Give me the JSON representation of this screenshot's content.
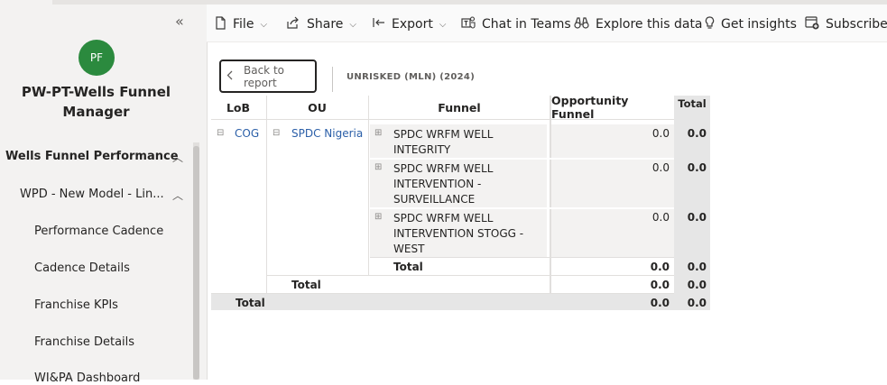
{
  "sidebar": {
    "collapse_glyph": "«",
    "avatar_initials": "PF",
    "app_title": "PW-PT-Wells Funnel Manager",
    "section": "Wells Funnel Performance",
    "subsection": "WPD - New Model - Lin...",
    "pages": [
      "Performance Cadence",
      "Cadence Details",
      "Franchise KPIs",
      "Franchise Details",
      "WI&PA Dashboard"
    ]
  },
  "toolbar": {
    "file": "File",
    "share": "Share",
    "export": "Export",
    "chat": "Chat in Teams",
    "explore": "Explore this data",
    "insights": "Get insights",
    "subscribe": "Subscribe t"
  },
  "report": {
    "back_label": "Back to report",
    "filter_label": "UNRISKED (MLN) (2024)",
    "headers": {
      "lob": "LoB",
      "ou": "OU",
      "funnel": "Funnel",
      "opportunity": "Opportunity Funnel",
      "total": "Total"
    },
    "lob": "COG",
    "ou": "SPDC Nigeria",
    "rows": [
      {
        "funnel_lines": [
          "SPDC WRFM WELL",
          "INTEGRITY"
        ],
        "opportunity": "0.0",
        "total": "0.0"
      },
      {
        "funnel_lines": [
          "SPDC WRFM WELL",
          "INTERVENTION -",
          "SURVEILLANCE"
        ],
        "opportunity": "0.0",
        "total": "0.0"
      },
      {
        "funnel_lines": [
          "SPDC WRFM WELL",
          "INTERVENTION STOGG -",
          "WEST"
        ],
        "opportunity": "0.0",
        "total": "0.0"
      }
    ],
    "funnel_total": {
      "label": "Total",
      "opportunity": "0.0",
      "total": "0.0"
    },
    "ou_total": {
      "label": "Total",
      "opportunity": "0.0",
      "total": "0.0"
    },
    "grand_total": {
      "label": "Total",
      "opportunity": "0.0",
      "total": "0.0"
    }
  }
}
